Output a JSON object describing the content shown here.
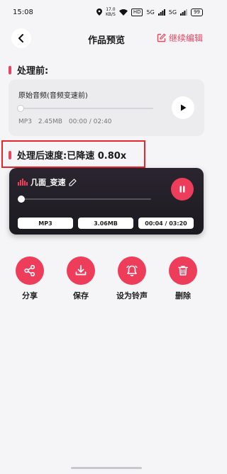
{
  "status_bar": {
    "time": "15:08",
    "net_speed_value": "17.0",
    "net_speed_unit": "KB/S",
    "hd": "HD",
    "network": "5G",
    "battery": "99"
  },
  "nav": {
    "title": "作品预览",
    "continue_label": "继续编辑"
  },
  "before": {
    "section_title": "处理前:",
    "audio_name": "原始音频(音频变速前)",
    "format": "MP3",
    "size": "2.45MB",
    "time": "00:00 / 02:40",
    "progress": 0
  },
  "after": {
    "section_title": "处理后速度:已降速 0.80x",
    "audio_name": "几面_变速",
    "format": "MP3",
    "size": "3.06MB",
    "time": "00:04 / 03:20",
    "progress": 0.02
  },
  "actions": [
    {
      "label": "分享",
      "icon": "share-icon"
    },
    {
      "label": "保存",
      "icon": "download-icon"
    },
    {
      "label": "设为铃声",
      "icon": "bell-icon"
    },
    {
      "label": "删除",
      "icon": "trash-icon"
    }
  ],
  "colors": {
    "accent": "#ee3d5b",
    "highlight": "#e4262e"
  }
}
